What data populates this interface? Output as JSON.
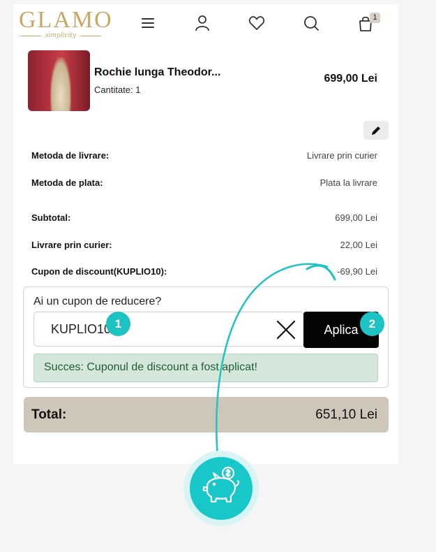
{
  "header": {
    "logo_text": "GLAMO",
    "logo_tagline": "simplicity",
    "cart_count": "1",
    "icons": [
      "menu-icon",
      "user-icon",
      "heart-icon",
      "search-icon",
      "cart-icon"
    ]
  },
  "product": {
    "name": "Rochie lunga Theodor...",
    "quantity_label": "Cantitate: 1",
    "price": "699,00 Lei"
  },
  "summary": {
    "delivery_label": "Metoda de livrare:",
    "delivery_value": "Livrare prin curier",
    "payment_label": "Metoda de plata:",
    "payment_value": "Plata la livrare",
    "subtotal_label": "Subtotal:",
    "subtotal_value": "699,00 Lei",
    "shipping_label": "Livrare prin curier:",
    "shipping_value": "22,00 Lei",
    "discount_label": "Cupon de discount(KUPLIO10):",
    "discount_value": "-69,90 Lei"
  },
  "coupon": {
    "title": "Ai un cupon de reducere?",
    "value": "KUPLIO10",
    "apply_label": "Aplica",
    "success_message": "Succes: Cuponul de discount a fost aplicat!"
  },
  "total": {
    "label": "Total:",
    "value": "651,10 Lei"
  },
  "steps": {
    "step1": "1",
    "step2": "2"
  },
  "colors": {
    "accent": "#1dc3c3",
    "logo_gold": "#c9a766",
    "total_bar": "#cec7b9",
    "success_bg": "#d5e7db",
    "success_text": "#1f5d33"
  }
}
